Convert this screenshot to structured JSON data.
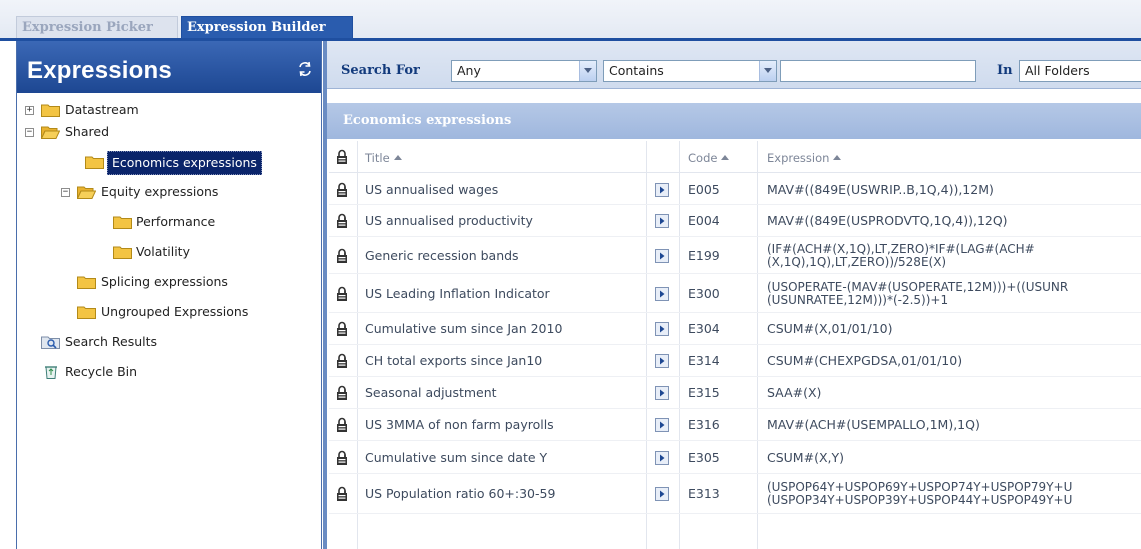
{
  "tabs": {
    "picker": "Expression Picker",
    "builder": "Expression Builder"
  },
  "sidebar": {
    "title": "Expressions",
    "tree": {
      "datastream": "Datastream",
      "shared": "Shared",
      "economics": "Economics expressions",
      "equity": "Equity expressions",
      "performance": "Performance",
      "volatility": "Volatility",
      "splicing": "Splicing expressions",
      "ungrouped": "Ungrouped Expressions",
      "search_results": "Search Results",
      "recycle_bin": "Recycle Bin"
    }
  },
  "search": {
    "label": "Search For",
    "field_value": "Any",
    "match_value": "Contains",
    "text_value": "",
    "in_label": "In",
    "folder_value": "All Folders"
  },
  "results": {
    "title": "Economics expressions",
    "columns": {
      "title": "Title",
      "code": "Code",
      "expression": "Expression"
    },
    "rows": [
      {
        "title": "US annualised wages",
        "code": "E005",
        "expr1": "MAV#((849E(USWRIP..B,1Q,4)),12M)",
        "expr2": ""
      },
      {
        "title": "US annualised productivity",
        "code": "E004",
        "expr1": "MAV#((849E(USPRODVTQ,1Q,4)),12Q)",
        "expr2": ""
      },
      {
        "title": "Generic recession bands",
        "code": "E199",
        "expr1": "(IF#(ACH#(X,1Q),LT,ZERO)*IF#(LAG#(ACH#",
        "expr2": "(X,1Q),1Q),LT,ZERO))/528E(X)"
      },
      {
        "title": "US Leading Inflation Indicator",
        "code": "E300",
        "expr1": "(USOPERATE-(MAV#(USOPERATE,12M)))+((USUNR",
        "expr2": "(USUNRATEE,12M)))*(-2.5))+1"
      },
      {
        "title": "Cumulative sum since Jan 2010",
        "code": "E304",
        "expr1": "CSUM#(X,01/01/10)",
        "expr2": ""
      },
      {
        "title": "CH total exports since Jan10",
        "code": "E314",
        "expr1": "CSUM#(CHEXPGDSA,01/01/10)",
        "expr2": ""
      },
      {
        "title": "Seasonal adjustment",
        "code": "E315",
        "expr1": "SAA#(X)",
        "expr2": ""
      },
      {
        "title": "US 3MMA of non farm payrolls",
        "code": "E316",
        "expr1": "MAV#(ACH#(USEMPALLO,1M),1Q)",
        "expr2": ""
      },
      {
        "title": "Cumulative sum since date Y",
        "code": "E305",
        "expr1": "CSUM#(X,Y)",
        "expr2": ""
      },
      {
        "title": "US Population ratio 60+:30-59",
        "code": "E313",
        "expr1": "(USPOP64Y+USPOP69Y+USPOP74Y+USPOP79Y+U",
        "expr2": "(USPOP34Y+USPOP39Y+USPOP44Y+USPOP49Y+U"
      }
    ]
  },
  "colors": {
    "accent": "#1f4fa0",
    "header_dark": "#1d4792",
    "selected": "#0a246a",
    "folder": "#f3c443"
  }
}
